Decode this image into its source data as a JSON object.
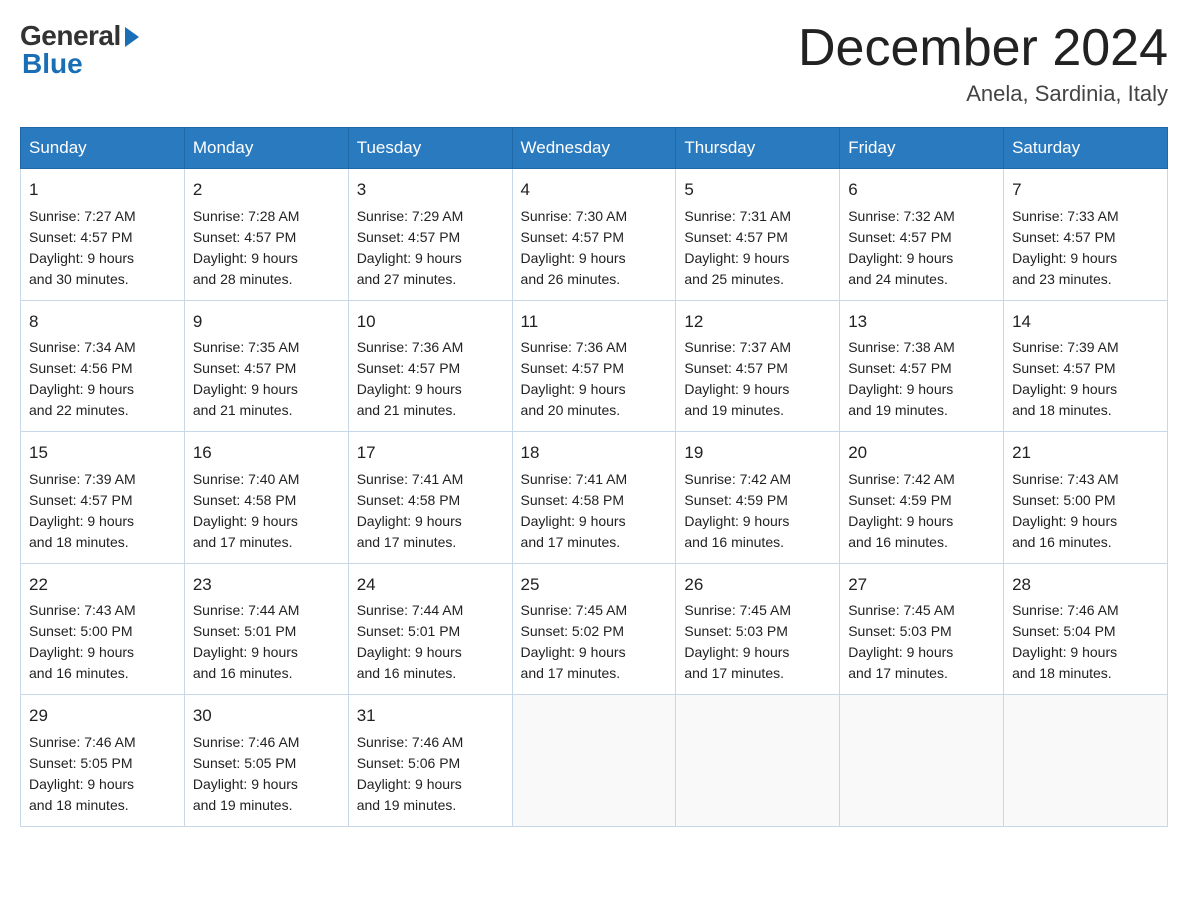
{
  "logo": {
    "general": "General",
    "blue": "Blue"
  },
  "title": "December 2024",
  "subtitle": "Anela, Sardinia, Italy",
  "days_header": [
    "Sunday",
    "Monday",
    "Tuesday",
    "Wednesday",
    "Thursday",
    "Friday",
    "Saturday"
  ],
  "weeks": [
    [
      {
        "num": "1",
        "sunrise": "7:27 AM",
        "sunset": "4:57 PM",
        "daylight": "9 hours and 30 minutes."
      },
      {
        "num": "2",
        "sunrise": "7:28 AM",
        "sunset": "4:57 PM",
        "daylight": "9 hours and 28 minutes."
      },
      {
        "num": "3",
        "sunrise": "7:29 AM",
        "sunset": "4:57 PM",
        "daylight": "9 hours and 27 minutes."
      },
      {
        "num": "4",
        "sunrise": "7:30 AM",
        "sunset": "4:57 PM",
        "daylight": "9 hours and 26 minutes."
      },
      {
        "num": "5",
        "sunrise": "7:31 AM",
        "sunset": "4:57 PM",
        "daylight": "9 hours and 25 minutes."
      },
      {
        "num": "6",
        "sunrise": "7:32 AM",
        "sunset": "4:57 PM",
        "daylight": "9 hours and 24 minutes."
      },
      {
        "num": "7",
        "sunrise": "7:33 AM",
        "sunset": "4:57 PM",
        "daylight": "9 hours and 23 minutes."
      }
    ],
    [
      {
        "num": "8",
        "sunrise": "7:34 AM",
        "sunset": "4:56 PM",
        "daylight": "9 hours and 22 minutes."
      },
      {
        "num": "9",
        "sunrise": "7:35 AM",
        "sunset": "4:57 PM",
        "daylight": "9 hours and 21 minutes."
      },
      {
        "num": "10",
        "sunrise": "7:36 AM",
        "sunset": "4:57 PM",
        "daylight": "9 hours and 21 minutes."
      },
      {
        "num": "11",
        "sunrise": "7:36 AM",
        "sunset": "4:57 PM",
        "daylight": "9 hours and 20 minutes."
      },
      {
        "num": "12",
        "sunrise": "7:37 AM",
        "sunset": "4:57 PM",
        "daylight": "9 hours and 19 minutes."
      },
      {
        "num": "13",
        "sunrise": "7:38 AM",
        "sunset": "4:57 PM",
        "daylight": "9 hours and 19 minutes."
      },
      {
        "num": "14",
        "sunrise": "7:39 AM",
        "sunset": "4:57 PM",
        "daylight": "9 hours and 18 minutes."
      }
    ],
    [
      {
        "num": "15",
        "sunrise": "7:39 AM",
        "sunset": "4:57 PM",
        "daylight": "9 hours and 18 minutes."
      },
      {
        "num": "16",
        "sunrise": "7:40 AM",
        "sunset": "4:58 PM",
        "daylight": "9 hours and 17 minutes."
      },
      {
        "num": "17",
        "sunrise": "7:41 AM",
        "sunset": "4:58 PM",
        "daylight": "9 hours and 17 minutes."
      },
      {
        "num": "18",
        "sunrise": "7:41 AM",
        "sunset": "4:58 PM",
        "daylight": "9 hours and 17 minutes."
      },
      {
        "num": "19",
        "sunrise": "7:42 AM",
        "sunset": "4:59 PM",
        "daylight": "9 hours and 16 minutes."
      },
      {
        "num": "20",
        "sunrise": "7:42 AM",
        "sunset": "4:59 PM",
        "daylight": "9 hours and 16 minutes."
      },
      {
        "num": "21",
        "sunrise": "7:43 AM",
        "sunset": "5:00 PM",
        "daylight": "9 hours and 16 minutes."
      }
    ],
    [
      {
        "num": "22",
        "sunrise": "7:43 AM",
        "sunset": "5:00 PM",
        "daylight": "9 hours and 16 minutes."
      },
      {
        "num": "23",
        "sunrise": "7:44 AM",
        "sunset": "5:01 PM",
        "daylight": "9 hours and 16 minutes."
      },
      {
        "num": "24",
        "sunrise": "7:44 AM",
        "sunset": "5:01 PM",
        "daylight": "9 hours and 16 minutes."
      },
      {
        "num": "25",
        "sunrise": "7:45 AM",
        "sunset": "5:02 PM",
        "daylight": "9 hours and 17 minutes."
      },
      {
        "num": "26",
        "sunrise": "7:45 AM",
        "sunset": "5:03 PM",
        "daylight": "9 hours and 17 minutes."
      },
      {
        "num": "27",
        "sunrise": "7:45 AM",
        "sunset": "5:03 PM",
        "daylight": "9 hours and 17 minutes."
      },
      {
        "num": "28",
        "sunrise": "7:46 AM",
        "sunset": "5:04 PM",
        "daylight": "9 hours and 18 minutes."
      }
    ],
    [
      {
        "num": "29",
        "sunrise": "7:46 AM",
        "sunset": "5:05 PM",
        "daylight": "9 hours and 18 minutes."
      },
      {
        "num": "30",
        "sunrise": "7:46 AM",
        "sunset": "5:05 PM",
        "daylight": "9 hours and 19 minutes."
      },
      {
        "num": "31",
        "sunrise": "7:46 AM",
        "sunset": "5:06 PM",
        "daylight": "9 hours and 19 minutes."
      },
      null,
      null,
      null,
      null
    ]
  ],
  "labels": {
    "sunrise": "Sunrise:",
    "sunset": "Sunset:",
    "daylight": "Daylight:"
  }
}
